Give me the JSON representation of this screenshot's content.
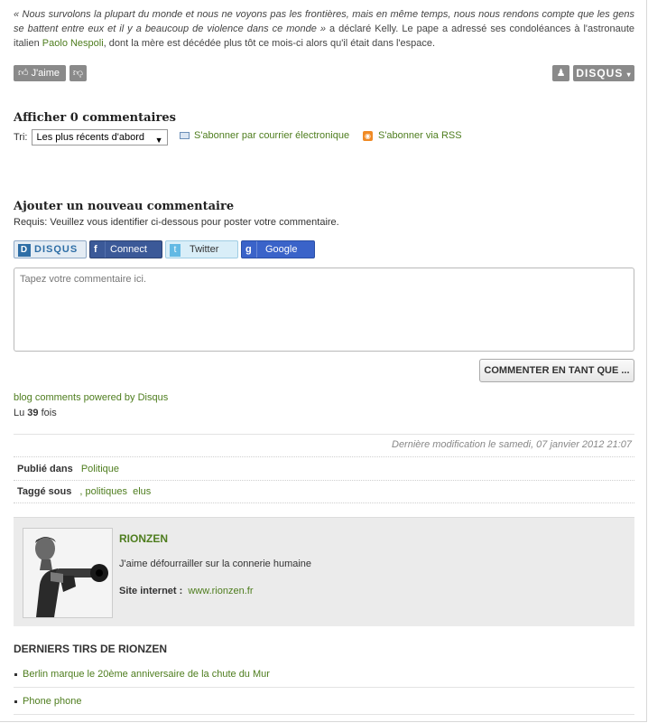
{
  "article": {
    "quote": "« Nous survolons la plupart du monde et nous ne voyons pas les frontières, mais en même temps, nous nous rendons compte que les gens se battent entre eux et il y a beaucoup de violence dans ce monde »",
    "after_quote": " a déclaré Kelly. Le pape a adressé ses condoléances à l'astronaute italien ",
    "link": "Paolo Nespoli",
    "after_link": ", dont la mère est décédée plus tôt ce mois-ci alors qu'il était dans l'espace."
  },
  "reactions": {
    "like_label": "J'aime",
    "brand": "DISQUS"
  },
  "comments": {
    "title": "Afficher 0 commentaires",
    "sort_label": "Tri:",
    "sort_value": "Les plus récents d'abord",
    "subscribe_email": "S'abonner par courrier électronique",
    "subscribe_rss": "S'abonner via RSS"
  },
  "add_comment": {
    "title": "Ajouter un nouveau commentaire",
    "required": "Requis: Veuillez vous identifier ci-dessous pour poster votre commentaire.",
    "login": {
      "disqus": "DISQUS",
      "facebook": "Connect",
      "twitter": "Twitter",
      "google": "Google"
    },
    "placeholder": "Tapez votre commentaire ici.",
    "post_button": "COMMENTER EN TANT QUE ..."
  },
  "footer": {
    "powered": "blog comments powered by Disqus",
    "hits_prefix": "Lu ",
    "hits_count": "39",
    "hits_suffix": " fois",
    "modified": "Dernière modification le samedi, 07 janvier 2012 21:07",
    "published_label": "Publié dans",
    "published_value": "Politique",
    "tags_label": "Taggé sous",
    "tags": [
      ", politiques",
      "elus"
    ]
  },
  "author": {
    "name": "RIONZEN",
    "bio": "J'aime défourrailler sur la connerie humaine",
    "site_label": "Site internet :",
    "site_url": "www.rionzen.fr"
  },
  "latest": {
    "title": "DERNIERS TIRS DE RIONZEN",
    "items": [
      "Berlin marque le 20ème anniversaire de la chute du Mur",
      "Phone phone"
    ]
  },
  "colors": {
    "link": "#4e7d1e",
    "facebook": "#3b5998",
    "google": "#3a63c9",
    "rss": "#f08a24"
  }
}
